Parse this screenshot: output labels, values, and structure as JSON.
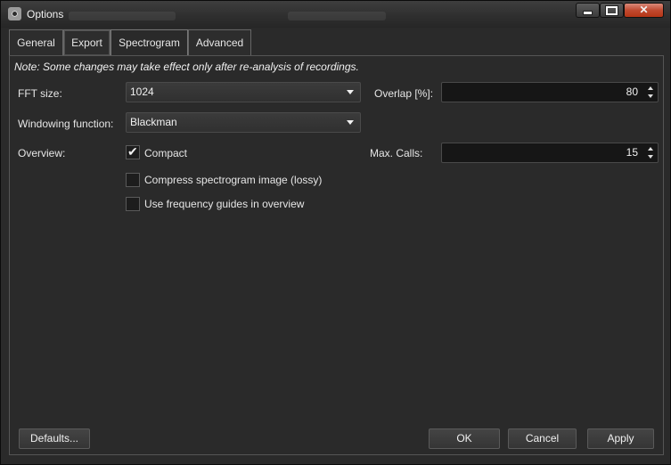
{
  "window": {
    "title": "Options",
    "title_icon": "gear-icon"
  },
  "tabs": [
    {
      "label": "General"
    },
    {
      "label": "Export"
    },
    {
      "label": "Spectrogram"
    },
    {
      "label": "Advanced"
    }
  ],
  "active_tab": "Spectrogram",
  "note": "Note: Some changes may take effect only after re-analysis of recordings.",
  "fft": {
    "label": "FFT size:",
    "value": "1024"
  },
  "overlap": {
    "label": "Overlap [%]:",
    "value": "80"
  },
  "windowing": {
    "label": "Windowing function:",
    "value": "Blackman"
  },
  "overview": {
    "label": "Overview:",
    "options": [
      {
        "label": "Compact",
        "checked": true
      },
      {
        "label": "Compress spectrogram image (lossy)",
        "checked": false
      },
      {
        "label": "Use frequency guides in overview",
        "checked": false
      }
    ]
  },
  "max_calls": {
    "label": "Max. Calls:",
    "value": "15"
  },
  "buttons": {
    "defaults": "Defaults...",
    "ok": "OK",
    "cancel": "Cancel",
    "apply": "Apply"
  },
  "colors": {
    "background": "#2a2a2a",
    "close_button": "#c14a30",
    "input_bg": "#161616"
  }
}
